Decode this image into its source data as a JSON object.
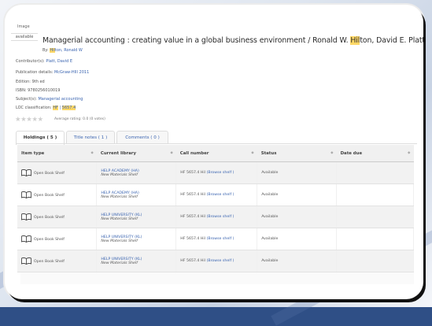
{
  "colors": {
    "link": "#3a64b0",
    "highlight": "#ffd866",
    "frame_bg": "#ffffff",
    "outer_bg": "#2f4f86"
  },
  "thumbnail": {
    "line1": "Image",
    "line2": "available"
  },
  "record": {
    "title_pre": "Managerial accounting : creating value in a global business environment / Ronald W. ",
    "title_hl": "Hil",
    "title_post": "ton, David E. Platt",
    "by_label": "By:",
    "author1_hl": "Hil",
    "author1_rest": "ton, Ronald W",
    "contributors_label": "Contributor(s):",
    "contributors_value": "Platt, David E",
    "publication_label": "Publication details:",
    "publication_value": "McGraw-HIll 2011",
    "edition": "Edition: 9th ed",
    "isbn": "ISBN: 9780256010019",
    "subjects_label": "Subject(s):",
    "subjects_value": "Managerial accounting",
    "lcc_label": "LOC classification:",
    "lcc_hl": "HF",
    "lcc_sep": " | ",
    "lcc_value": "5657.4",
    "stars": "★★★★★",
    "rating_text": "Average rating: 0.0 (0 votes)"
  },
  "tabs": [
    {
      "label": "Holdings ( 5 )"
    },
    {
      "label": "Title notes ( 1 )"
    },
    {
      "label": "Comments ( 0 )"
    }
  ],
  "table": {
    "headers": [
      "Item type",
      "Current library",
      "Call number",
      "Status",
      "Date due"
    ],
    "sort_icon": "◆",
    "rows": [
      {
        "item_type": "Open Book Shelf",
        "library": "HELP ACADEMY (HA)",
        "location": "New Materials Shelf",
        "call": "HF 5657.4 Hil",
        "browse": "(Browse shelf )",
        "status": "Available",
        "due": ""
      },
      {
        "item_type": "Open Book Shelf",
        "library": "HELP ACADEMY (HA)",
        "location": "New Materials Shelf",
        "call": "HF 5657.4 Hil",
        "browse": "(Browse shelf )",
        "status": "Available",
        "due": ""
      },
      {
        "item_type": "Open Book Shelf",
        "library": "HELP UNIVERSITY (KL)",
        "location": "New Materials Shelf",
        "call": "HF 5657.4 Hil",
        "browse": "(Browse shelf )",
        "status": "Available",
        "due": ""
      },
      {
        "item_type": "Open Book Shelf",
        "library": "HELP UNIVERSITY (KL)",
        "location": "New Materials Shelf",
        "call": "HF 5657.4 Hil",
        "browse": "(Browse shelf )",
        "status": "Available",
        "due": ""
      },
      {
        "item_type": "Open Book Shelf",
        "library": "HELP UNIVERSITY (KL)",
        "location": "New Materials Shelf",
        "call": "HF 5657.4 Hil",
        "browse": "(Browse shelf )",
        "status": "Available",
        "due": ""
      }
    ]
  }
}
